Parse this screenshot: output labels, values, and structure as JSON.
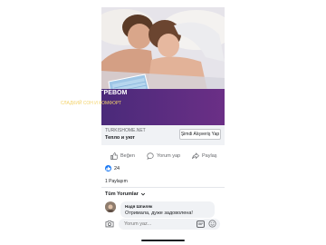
{
  "ad": {
    "banner_title": "ПРОСТЫНЯ С ПОДОГРЕВОМ",
    "banner_subtitle": "СЛАДКИЙ СОН И КОМФОРТ",
    "domain": "TURKISHOME.NET",
    "link_title": "Тепло и уют",
    "cta_label": "Şimdi Alışveriş Yap"
  },
  "actions": {
    "like_label": "Beğen",
    "comment_label": "Yorum yap",
    "share_label": "Paylaş"
  },
  "stats": {
    "reactions_count": "24",
    "shares_text": "1 Paylaşım"
  },
  "comments": {
    "filter_label": "Tüm Yorumlar",
    "items": [
      {
        "author": "Надя Шпиляк",
        "text": "Отримала, дуже задоволена!"
      }
    ]
  },
  "composer": {
    "placeholder": "Yorum yaz..."
  },
  "colors": {
    "accent": "#1877f2",
    "banner_purple": "#5b2c83",
    "banner_subtitle": "#f3d36b"
  }
}
